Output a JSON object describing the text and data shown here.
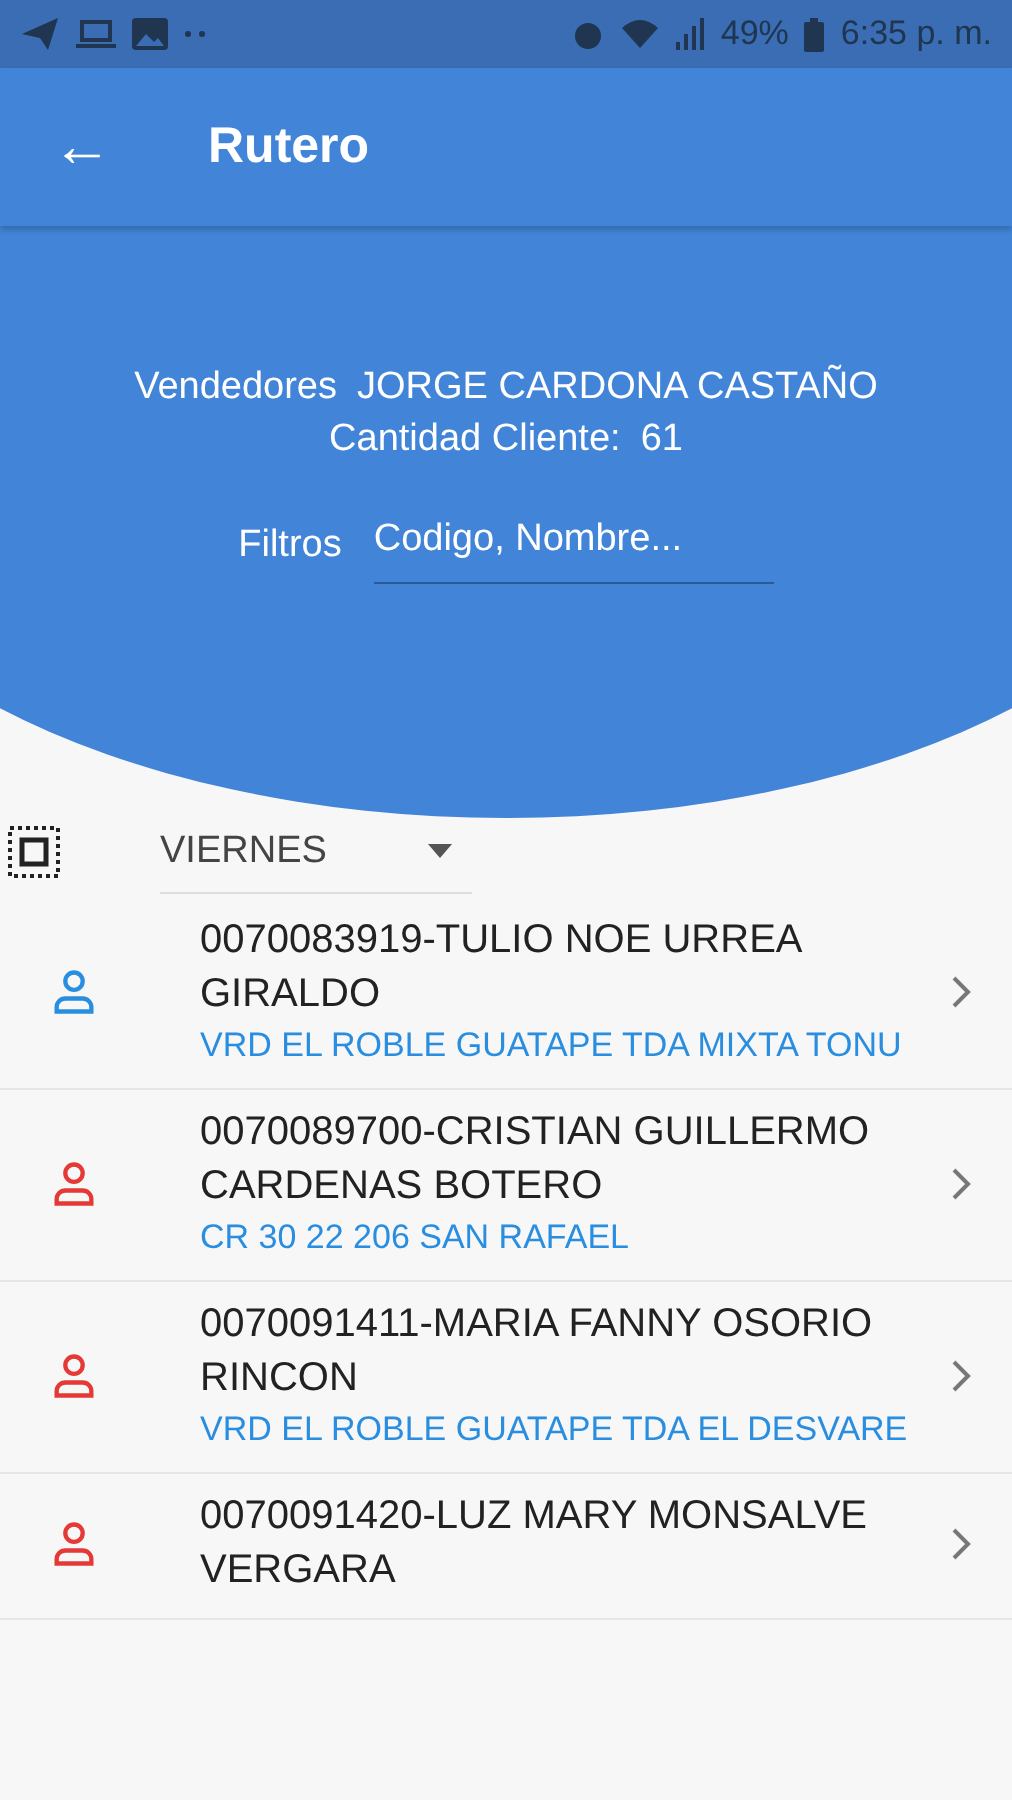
{
  "status_bar": {
    "battery": "49%",
    "time": "6:35 p. m."
  },
  "app_bar": {
    "back": "←",
    "title": "Rutero"
  },
  "header": {
    "seller_label": "Vendedores",
    "seller": "JORGE CARDONA CASTAÑO",
    "count_label": "Cantidad Cliente:",
    "count": "61",
    "filter_label": "Filtros",
    "filter_placeholder": "Codigo, Nombre..."
  },
  "day_select": {
    "value": "VIERNES"
  },
  "clients": [
    {
      "name": "0070083919-TULIO NOE URREA GIRALDO",
      "address": "VRD EL ROBLE GUATAPE TDA MIXTA TONU",
      "color": "#2a8ee0"
    },
    {
      "name": "0070089700-CRISTIAN GUILLERMO CARDENAS BOTERO",
      "address": "CR 30 22 206 SAN RAFAEL",
      "color": "#e53935"
    },
    {
      "name": "0070091411-MARIA FANNY OSORIO RINCON",
      "address": "VRD EL ROBLE GUATAPE TDA EL DESVARE",
      "color": "#e53935"
    },
    {
      "name": "0070091420-LUZ MARY MONSALVE VERGARA",
      "color": "#e53935"
    }
  ]
}
